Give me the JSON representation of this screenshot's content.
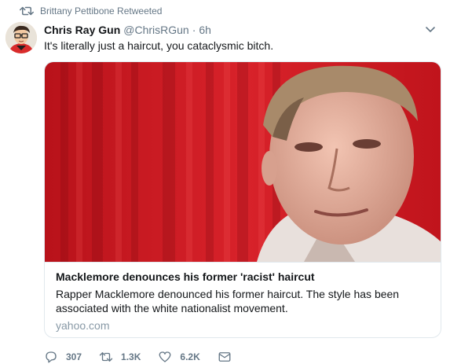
{
  "retweet": {
    "label": "Brittany Pettibone Retweeted",
    "icon": "retweet-icon"
  },
  "tweet": {
    "display_name": "Chris Ray Gun",
    "handle": "@ChrisRGun",
    "separator": "·",
    "time": "6h",
    "text": "It's literally just a haircut, you cataclysmic bitch.",
    "menu_icon": "chevron-down-icon"
  },
  "card": {
    "title": "Macklemore denounces his former 'racist' haircut",
    "description": "Rapper Macklemore denounced his former haircut. The style has been associated with the white nationalist movement.",
    "domain": "yahoo.com"
  },
  "actions": {
    "reply_count": "307",
    "retweet_count": "1.3K",
    "like_count": "6.2K"
  },
  "colors": {
    "secondary_text": "#657786",
    "border": "#e1e8ed",
    "domain_text": "#8899a6",
    "card_background_red": "#c8151b"
  }
}
